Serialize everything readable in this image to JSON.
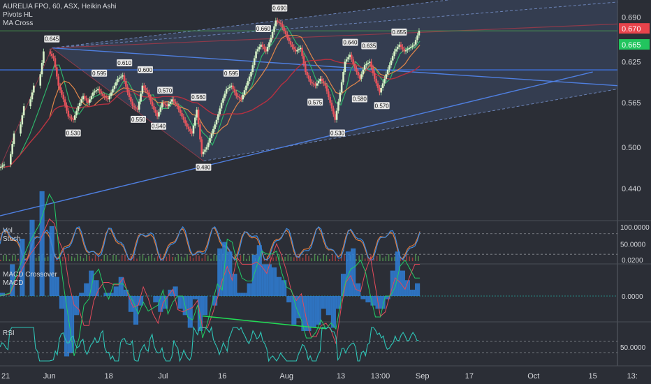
{
  "header": {
    "title": "AURELIA FPO, 60, ASX, Heikin Ashi",
    "indicators": [
      "Pivots HL",
      "MA Cross"
    ]
  },
  "panes": {
    "stoch": {
      "labels": [
        "Vol",
        "Stoch"
      ],
      "ticks": [
        "100.0000",
        "50.0000"
      ]
    },
    "macd": {
      "labels": [
        "MACD Crossover",
        "MACD"
      ],
      "ticks": [
        "0.0200",
        "0.0000"
      ]
    },
    "rsi": {
      "labels": [
        "RSI"
      ],
      "ticks": [
        "50.0000"
      ]
    }
  },
  "chart_data": {
    "type": "candlestick",
    "symbol": "AURELIA FPO",
    "interval": "60",
    "exchange": "ASX",
    "style": "Heikin Ashi",
    "price_axis_ticks": [
      "0.690",
      "0.625",
      "0.565",
      "0.500",
      "0.440"
    ],
    "price_range": [
      0.395,
      0.715
    ],
    "time_axis_ticks": [
      "21",
      "Jun",
      "18",
      "Jul",
      "16",
      "Aug",
      "13",
      "13:00",
      "Sep",
      "17",
      "Oct",
      "15",
      "13:"
    ],
    "last_price_labels": [
      {
        "value": "0.670",
        "color": "#e8434b"
      },
      {
        "value": "0.665",
        "color": "#22c55e"
      }
    ],
    "pivot_labels": [
      {
        "text": "0.645",
        "kind": "high",
        "time": 10.5,
        "price": 0.645
      },
      {
        "text": "0.530",
        "kind": "low",
        "time": 14.8,
        "price": 0.53
      },
      {
        "text": "0.595",
        "kind": "high",
        "time": 20.1,
        "price": 0.595
      },
      {
        "text": "0.610",
        "kind": "high",
        "time": 25.2,
        "price": 0.61
      },
      {
        "text": "0.600",
        "kind": "high",
        "time": 29.4,
        "price": 0.6
      },
      {
        "text": "0.550",
        "kind": "low",
        "time": 28.0,
        "price": 0.55
      },
      {
        "text": "0.540",
        "kind": "low",
        "time": 32.1,
        "price": 0.54
      },
      {
        "text": "0.570",
        "kind": "high",
        "time": 33.4,
        "price": 0.57
      },
      {
        "text": "0.560",
        "kind": "high",
        "time": 40.2,
        "price": 0.56
      },
      {
        "text": "0.480",
        "kind": "low",
        "time": 41.2,
        "price": 0.48
      },
      {
        "text": "0.595",
        "kind": "high",
        "time": 46.8,
        "price": 0.595
      },
      {
        "text": "0.660",
        "kind": "high",
        "time": 53.3,
        "price": 0.66
      },
      {
        "text": "0.690",
        "kind": "high",
        "time": 56.6,
        "price": 0.69
      },
      {
        "text": "0.575",
        "kind": "low",
        "time": 63.8,
        "price": 0.575
      },
      {
        "text": "0.530",
        "kind": "low",
        "time": 68.3,
        "price": 0.53
      },
      {
        "text": "0.640",
        "kind": "high",
        "time": 70.9,
        "price": 0.64
      },
      {
        "text": "0.635",
        "kind": "high",
        "time": 74.7,
        "price": 0.635
      },
      {
        "text": "0.580",
        "kind": "low",
        "time": 72.8,
        "price": 0.58
      },
      {
        "text": "0.570",
        "kind": "low",
        "time": 77.3,
        "price": 0.57
      },
      {
        "text": "0.655",
        "kind": "high",
        "time": 80.8,
        "price": 0.655
      }
    ],
    "close_series": [
      {
        "t": 0,
        "v": 0.47
      },
      {
        "t": 2,
        "v": 0.475
      },
      {
        "t": 4,
        "v": 0.52
      },
      {
        "t": 6,
        "v": 0.56
      },
      {
        "t": 8,
        "v": 0.59
      },
      {
        "t": 10,
        "v": 0.64
      },
      {
        "t": 11,
        "v": 0.63
      },
      {
        "t": 12,
        "v": 0.59
      },
      {
        "t": 13,
        "v": 0.57
      },
      {
        "t": 14,
        "v": 0.545
      },
      {
        "t": 15,
        "v": 0.54
      },
      {
        "t": 16,
        "v": 0.56
      },
      {
        "t": 17,
        "v": 0.575
      },
      {
        "t": 18,
        "v": 0.565
      },
      {
        "t": 19,
        "v": 0.58
      },
      {
        "t": 20,
        "v": 0.585
      },
      {
        "t": 21,
        "v": 0.575
      },
      {
        "t": 22,
        "v": 0.57
      },
      {
        "t": 23,
        "v": 0.585
      },
      {
        "t": 24,
        "v": 0.6
      },
      {
        "t": 25,
        "v": 0.605
      },
      {
        "t": 26,
        "v": 0.58
      },
      {
        "t": 27,
        "v": 0.56
      },
      {
        "t": 28,
        "v": 0.555
      },
      {
        "t": 29,
        "v": 0.59
      },
      {
        "t": 30,
        "v": 0.58
      },
      {
        "t": 31,
        "v": 0.56
      },
      {
        "t": 32,
        "v": 0.545
      },
      {
        "t": 33,
        "v": 0.565
      },
      {
        "t": 34,
        "v": 0.56
      },
      {
        "t": 35,
        "v": 0.57
      },
      {
        "t": 36,
        "v": 0.56
      },
      {
        "t": 37,
        "v": 0.545
      },
      {
        "t": 38,
        "v": 0.53
      },
      {
        "t": 39,
        "v": 0.52
      },
      {
        "t": 40,
        "v": 0.555
      },
      {
        "t": 41,
        "v": 0.49
      },
      {
        "t": 42,
        "v": 0.5
      },
      {
        "t": 43,
        "v": 0.52
      },
      {
        "t": 44,
        "v": 0.54
      },
      {
        "t": 45,
        "v": 0.565
      },
      {
        "t": 46,
        "v": 0.585
      },
      {
        "t": 47,
        "v": 0.59
      },
      {
        "t": 48,
        "v": 0.575
      },
      {
        "t": 49,
        "v": 0.57
      },
      {
        "t": 50,
        "v": 0.59
      },
      {
        "t": 51,
        "v": 0.61
      },
      {
        "t": 52,
        "v": 0.64
      },
      {
        "t": 53,
        "v": 0.65
      },
      {
        "t": 54,
        "v": 0.64
      },
      {
        "t": 55,
        "v": 0.66
      },
      {
        "t": 56,
        "v": 0.685
      },
      {
        "t": 57,
        "v": 0.68
      },
      {
        "t": 58,
        "v": 0.665
      },
      {
        "t": 59,
        "v": 0.65
      },
      {
        "t": 60,
        "v": 0.64
      },
      {
        "t": 61,
        "v": 0.645
      },
      {
        "t": 62,
        "v": 0.61
      },
      {
        "t": 63,
        "v": 0.595
      },
      {
        "t": 64,
        "v": 0.59
      },
      {
        "t": 65,
        "v": 0.6
      },
      {
        "t": 66,
        "v": 0.59
      },
      {
        "t": 67,
        "v": 0.565
      },
      {
        "t": 68,
        "v": 0.54
      },
      {
        "t": 69,
        "v": 0.58
      },
      {
        "t": 70,
        "v": 0.625
      },
      {
        "t": 71,
        "v": 0.635
      },
      {
        "t": 72,
        "v": 0.615
      },
      {
        "t": 73,
        "v": 0.6
      },
      {
        "t": 74,
        "v": 0.62
      },
      {
        "t": 75,
        "v": 0.625
      },
      {
        "t": 76,
        "v": 0.6
      },
      {
        "t": 77,
        "v": 0.58
      },
      {
        "t": 78,
        "v": 0.6
      },
      {
        "t": 79,
        "v": 0.62
      },
      {
        "t": 80,
        "v": 0.64
      },
      {
        "t": 81,
        "v": 0.65
      },
      {
        "t": 82,
        "v": 0.64
      },
      {
        "t": 83,
        "v": 0.645
      },
      {
        "t": 84,
        "v": 0.65
      },
      {
        "t": 85,
        "v": 0.67
      }
    ],
    "horizontal_levels": [
      {
        "price": 0.67,
        "color": "#4caf50"
      },
      {
        "price": 0.613,
        "color": "#3d6fd6"
      }
    ],
    "macd_divergence": {
      "from": {
        "t": 41,
        "v": -0.011
      },
      "to": {
        "t": 66,
        "v": -0.018
      },
      "color": "#22dd55"
    }
  }
}
